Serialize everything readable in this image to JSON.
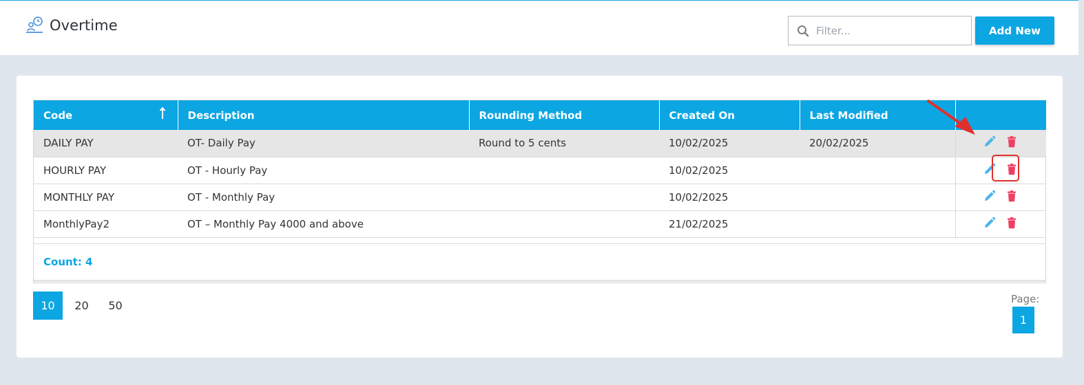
{
  "header": {
    "title": "Overtime",
    "title_icon": "overtime-icon",
    "filter_placeholder": "Filter...",
    "filter_value": "",
    "add_button_label": "Add New"
  },
  "table": {
    "columns": [
      "Code",
      "Description",
      "Rounding Method",
      "Created On",
      "Last Modified",
      ""
    ],
    "sort": {
      "column": "Code",
      "direction": "ascending"
    },
    "rows": [
      {
        "code": "DAILY PAY",
        "description": "OT- Daily Pay",
        "rounding": "Round to 5 cents",
        "created": "10/02/2025",
        "modified": "20/02/2025",
        "selected": true
      },
      {
        "code": "HOURLY PAY",
        "description": "OT - Hourly Pay",
        "rounding": "",
        "created": "10/02/2025",
        "modified": "",
        "selected": false
      },
      {
        "code": "MONTHLY PAY",
        "description": "OT - Monthly Pay",
        "rounding": "",
        "created": "10/02/2025",
        "modified": "",
        "selected": false
      },
      {
        "code": "MonthlyPay2",
        "description": "OT – Monthly Pay 4000 and above",
        "rounding": "",
        "created": "21/02/2025",
        "modified": "",
        "selected": false
      }
    ],
    "count_label": "Count: 4"
  },
  "pager": {
    "sizes": [
      "10",
      "20",
      "50"
    ],
    "active_size": "10",
    "page_label": "Page:",
    "current_page": "1"
  },
  "colors": {
    "accent": "#0ca6e3",
    "edit_icon": "#4fb3e8",
    "delete_icon": "#ef3f62",
    "highlight": "#e0302e"
  }
}
